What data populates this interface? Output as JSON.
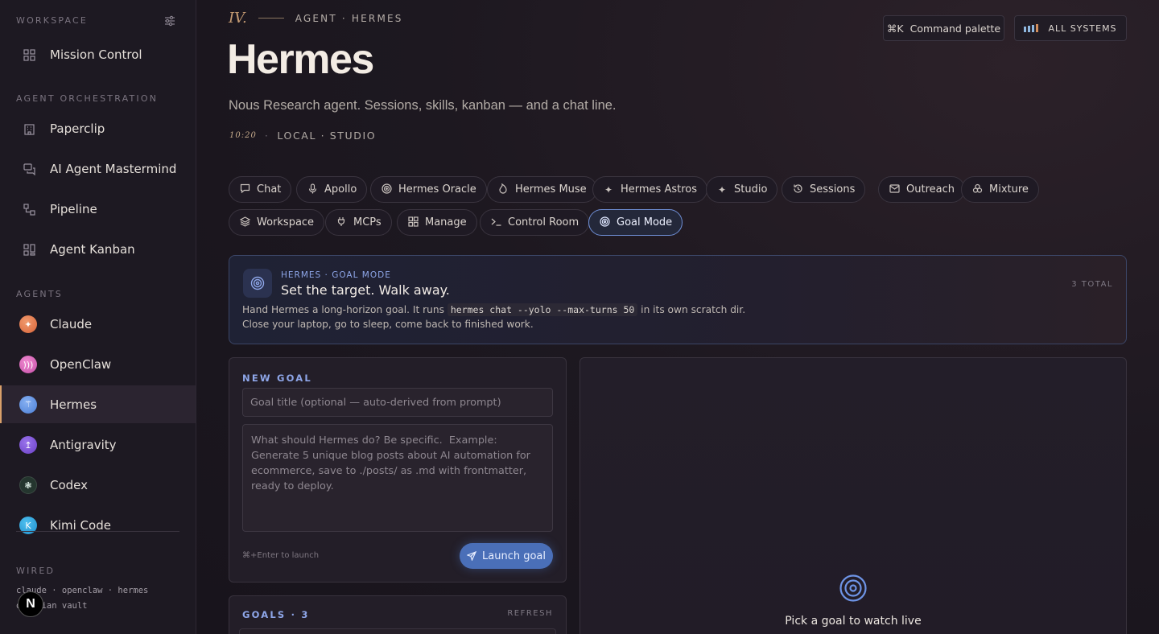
{
  "sidebar": {
    "workspace_label": "WORKSPACE",
    "mission_control": "Mission Control",
    "orchestration_label": "AGENT ORCHESTRATION",
    "orchestration": [
      "Paperclip",
      "AI Agent Mastermind",
      "Pipeline",
      "Agent Kanban"
    ],
    "agents_label": "AGENTS",
    "agents": [
      {
        "name": "Claude",
        "color": "#e0764a"
      },
      {
        "name": "OpenClaw",
        "color": "#d866b8"
      },
      {
        "name": "Hermes",
        "color": "#5b8fe0"
      },
      {
        "name": "Antigravity",
        "color": "#7a4fd0"
      },
      {
        "name": "Codex",
        "color": "#2a3a34"
      },
      {
        "name": "Kimi Code",
        "color": "#2a9fd6"
      }
    ],
    "active_agent": "Hermes",
    "wired_label": "WIRED",
    "wired_line1": "claude · openclaw · hermes",
    "wired_line2": "obsidian vault",
    "badge": "N"
  },
  "header": {
    "roman": "IV.",
    "eyebrow": "AGENT · HERMES",
    "title": "Hermes",
    "subtitle": "Nous Research agent. Sessions, skills, kanban — and a chat line.",
    "time": "10:20",
    "location": "LOCAL · STUDIO",
    "command_palette": "Command palette",
    "command_key": "⌘K",
    "systems": "ALL SYSTEMS"
  },
  "tabs": [
    {
      "label": "Chat",
      "icon": "chat-bubble-icon"
    },
    {
      "label": "Apollo",
      "icon": "microphone-icon"
    },
    {
      "label": "Hermes Oracle",
      "icon": "spiral-icon"
    },
    {
      "label": "Hermes Muse",
      "icon": "flame-icon"
    },
    {
      "label": "Hermes Astros",
      "icon": "sparkles-icon"
    },
    {
      "label": "Studio",
      "icon": "sparkles-icon"
    },
    {
      "label": "Sessions",
      "icon": "history-icon"
    },
    {
      "label": "Outreach",
      "icon": "mail-icon"
    },
    {
      "label": "Mixture",
      "icon": "circles-icon"
    },
    {
      "label": "Workspace",
      "icon": "layers-icon"
    },
    {
      "label": "MCPs",
      "icon": "plug-icon"
    },
    {
      "label": "Manage",
      "icon": "grid-icon"
    },
    {
      "label": "Control Room",
      "icon": "terminal-icon"
    },
    {
      "label": "Goal Mode",
      "icon": "target-icon"
    }
  ],
  "active_tab": "Goal Mode",
  "banner": {
    "tag": "HERMES · GOAL MODE",
    "headline": "Set the target. Walk away.",
    "desc_before": "Hand Hermes a long-horizon goal. It runs ",
    "desc_code": "hermes chat --yolo --max-turns 50",
    "desc_after": " in its own scratch dir. Close your laptop, go to sleep, come back to finished work.",
    "total": "3 TOTAL"
  },
  "new_goal": {
    "label": "NEW GOAL",
    "title_placeholder": "Goal title (optional — auto-derived from prompt)",
    "prompt_placeholder": "What should Hermes do? Be specific.  Example: Generate 5 unique blog posts about AI automation for ecommerce, save to ./posts/ as .md with frontmatter, ready to deploy.",
    "hint": "⌘+Enter to launch",
    "launch": "Launch goal"
  },
  "goals": {
    "label": "GOALS · 3",
    "refresh": "REFRESH"
  },
  "live": {
    "message": "Pick a goal to watch live"
  },
  "colors": {
    "accent_blue": "#8ea6e8",
    "accent_gold": "#c59b73",
    "launch_blue": "#4a6fb8"
  }
}
